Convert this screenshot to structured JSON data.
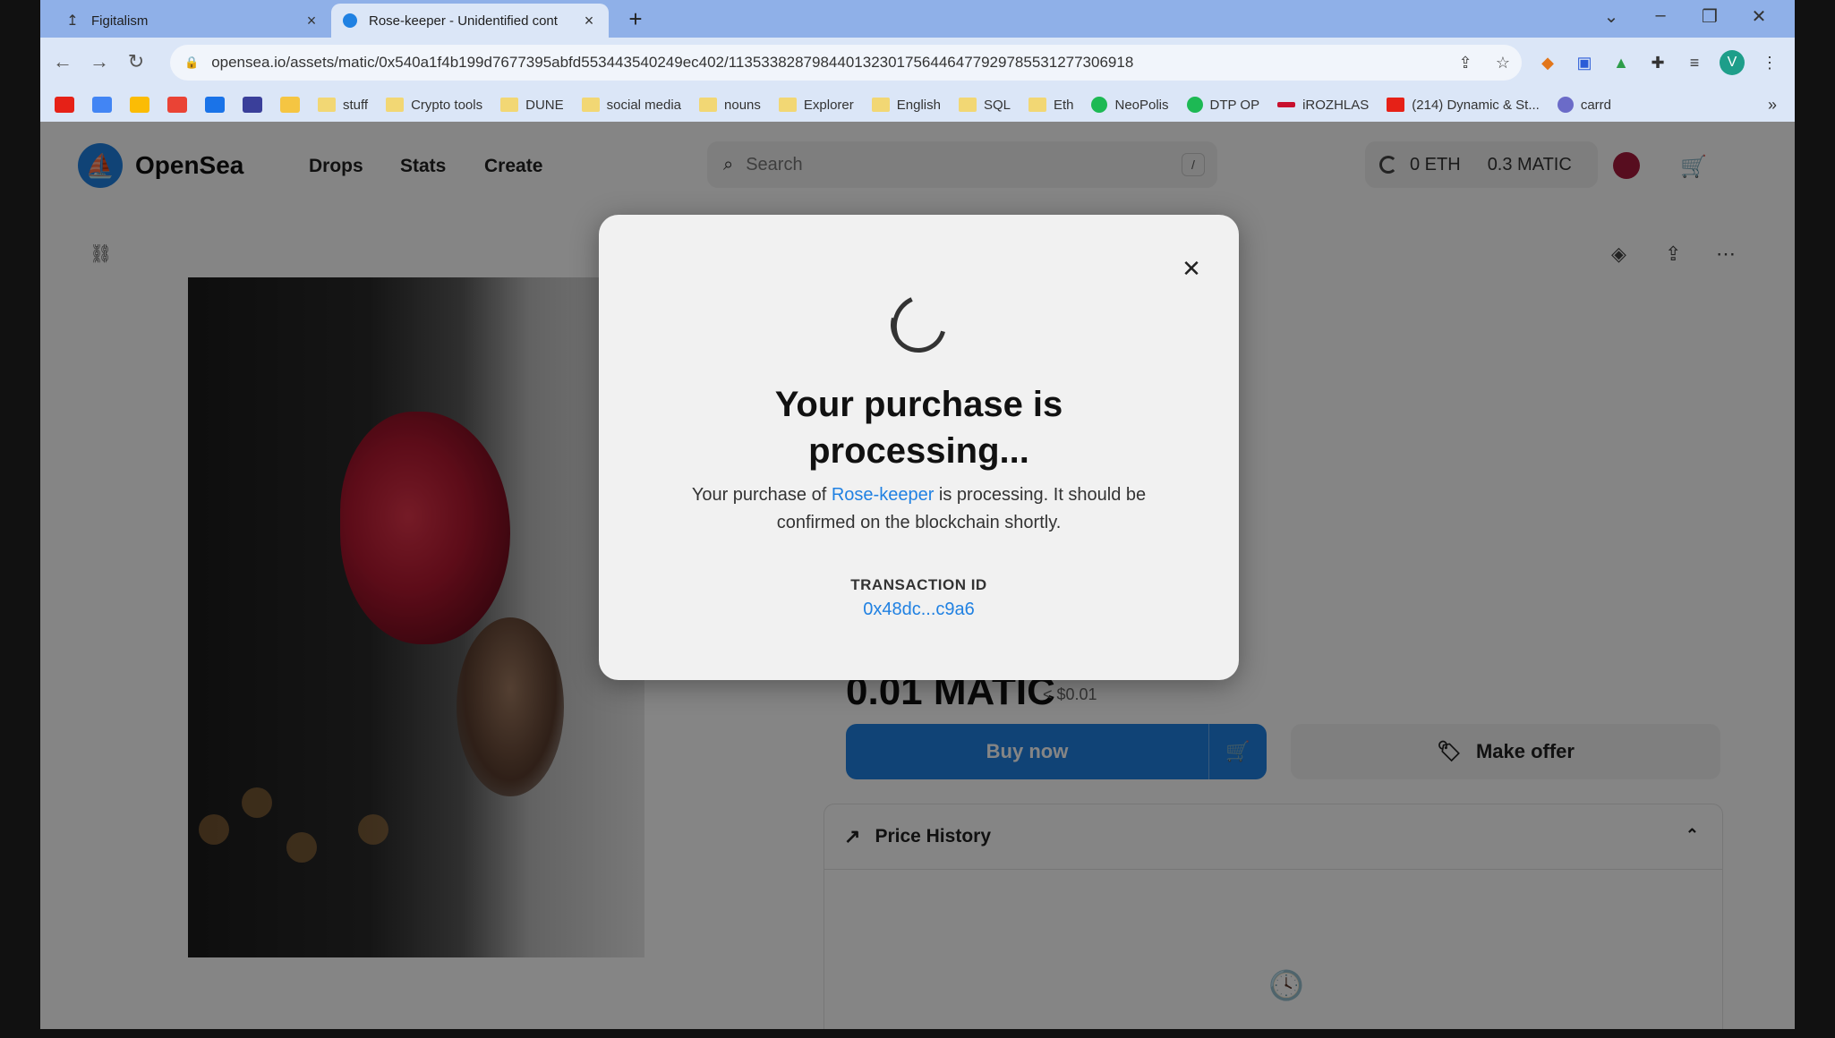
{
  "browser": {
    "tabs": [
      {
        "title": "Figitalism"
      },
      {
        "title": "Rose-keeper - Unidentified cont"
      }
    ],
    "url": "opensea.io/assets/matic/0x540a1f4b199d7677395abfd553443540249ec402/113533828798440132301756446477929785531277306918",
    "bookmarks": [
      "stuff",
      "Crypto tools",
      "DUNE",
      "social media",
      "nouns",
      "Explorer",
      "English",
      "SQL",
      "Eth",
      "NeoPolis",
      "DTP OP",
      "iROZHLAS",
      "(214) Dynamic & St...",
      "carrd"
    ],
    "profile_initial": "V",
    "bookmarks_more": "»"
  },
  "site": {
    "logo_text": "OpenSea",
    "nav": [
      "Drops",
      "Stats",
      "Create"
    ],
    "search_placeholder": "Search",
    "search_shortcut": "/",
    "wallet": {
      "eth": "0 ETH",
      "matic": "0.3 MATIC"
    }
  },
  "item": {
    "price": "0.01 MATIC",
    "price_usd": "< $0.01",
    "buy_now_label": "Buy now",
    "make_offer_label": "Make offer",
    "price_history_label": "Price History"
  },
  "modal": {
    "title": "Your purchase is processing...",
    "desc_prefix": "Your purchase of ",
    "desc_link": "Rose-keeper",
    "desc_suffix": " is processing. It should be confirmed on the blockchain shortly.",
    "tx_label": "TRANSACTION ID",
    "tx_id": "0x48dc...c9a6"
  },
  "colors": {
    "accent": "#2081e2",
    "tabstrip": "#8fb0e8",
    "toolbar": "#dbe6f7"
  }
}
